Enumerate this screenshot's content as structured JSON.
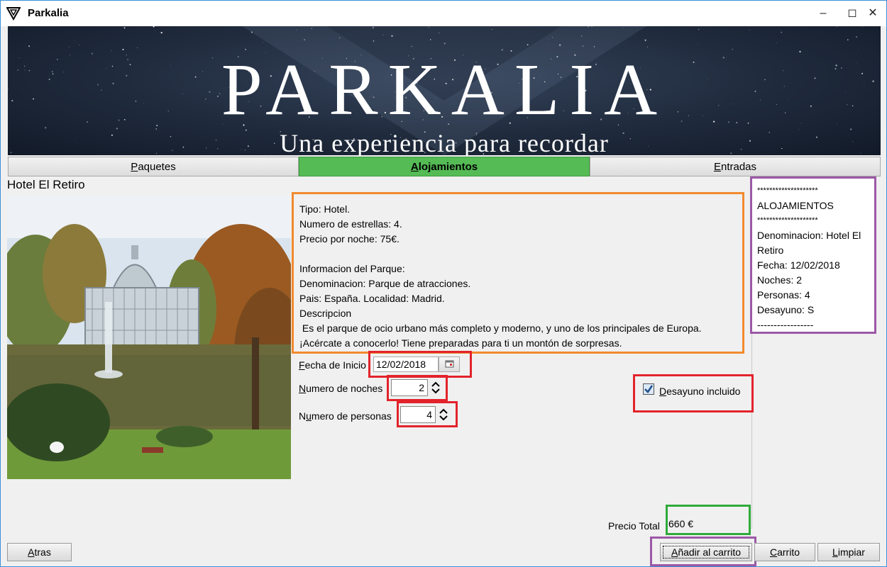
{
  "window": {
    "title": "Parkalia"
  },
  "banner": {
    "brand": "PARKALIA",
    "tagline": "Una experiencia para recordar"
  },
  "tabs": [
    {
      "label": "Paquetes",
      "accel": "P",
      "rest": "aquetes",
      "active": false
    },
    {
      "label": "Alojamientos",
      "accel": "A",
      "rest": "lojamientos",
      "active": true
    },
    {
      "label": "Entradas",
      "accel": "E",
      "rest": "ntradas",
      "active": false
    }
  ],
  "hotel": {
    "name": "Hotel El Retiro",
    "info_lines": [
      "Tipo: Hotel.",
      "Numero de estrellas: 4.",
      "Precio por noche: 75€.",
      "",
      "Informacion del Parque:",
      "Denominacion: Parque de atracciones.",
      "Pais: España. Localidad: Madrid.",
      "Descripcion",
      " Es el parque de ocio urbano más completo y moderno, y uno de los principales de Europa.",
      "¡Acércate a conocerlo! Tiene preparadas para ti un montón de sorpresas."
    ]
  },
  "form": {
    "fecha_label": "Fecha de Inicio",
    "fecha_accel": "F",
    "fecha_rest": "echa de Inicio",
    "fecha_value": "12/02/2018",
    "noches_label": "Numero de noches",
    "noches_accel": "N",
    "noches_rest": "umero de noches",
    "noches_value": "2",
    "personas_label": "Numero de personas",
    "personas_pre": "N",
    "personas_accel": "u",
    "personas_rest": "mero de personas",
    "personas_value": "4",
    "desayuno_label": "Desayuno incluido",
    "desayuno_accel": "D",
    "desayuno_rest": "esayuno incluido",
    "desayuno_checked": true
  },
  "cart": {
    "lines": [
      "********************",
      "ALOJAMIENTOS",
      "********************",
      "Denominacion: Hotel El",
      "Retiro",
      "Fecha: 12/02/2018",
      "Noches: 2",
      "Personas: 4",
      "Desayuno: S",
      "-----------------"
    ]
  },
  "total": {
    "label": "Precio Total",
    "value": "660 €"
  },
  "buttons": {
    "atras": {
      "label": "Atras",
      "accel": "A",
      "rest": "tras"
    },
    "anadir": {
      "label": "Añadir al carrito",
      "accel": "A",
      "rest": "ñadir al carrito"
    },
    "carrito": {
      "label": "Carrito",
      "accel": "C",
      "rest": "arrito"
    },
    "limpiar": {
      "label": "Limpiar",
      "accel": "L",
      "rest": "impiar"
    }
  },
  "colors": {
    "active_tab": "#55bb55",
    "highlight_orange": "#f28a2e",
    "highlight_red": "#e2232b",
    "highlight_purple": "#9b59a6",
    "highlight_green": "#2faa3b",
    "window_border": "#3a8fd6"
  },
  "icons": {
    "app": "parkalia-logo-icon",
    "calendar": "calendar-icon",
    "spinner": "spinner-arrows-icon",
    "checkbox": "checkmark-icon"
  }
}
